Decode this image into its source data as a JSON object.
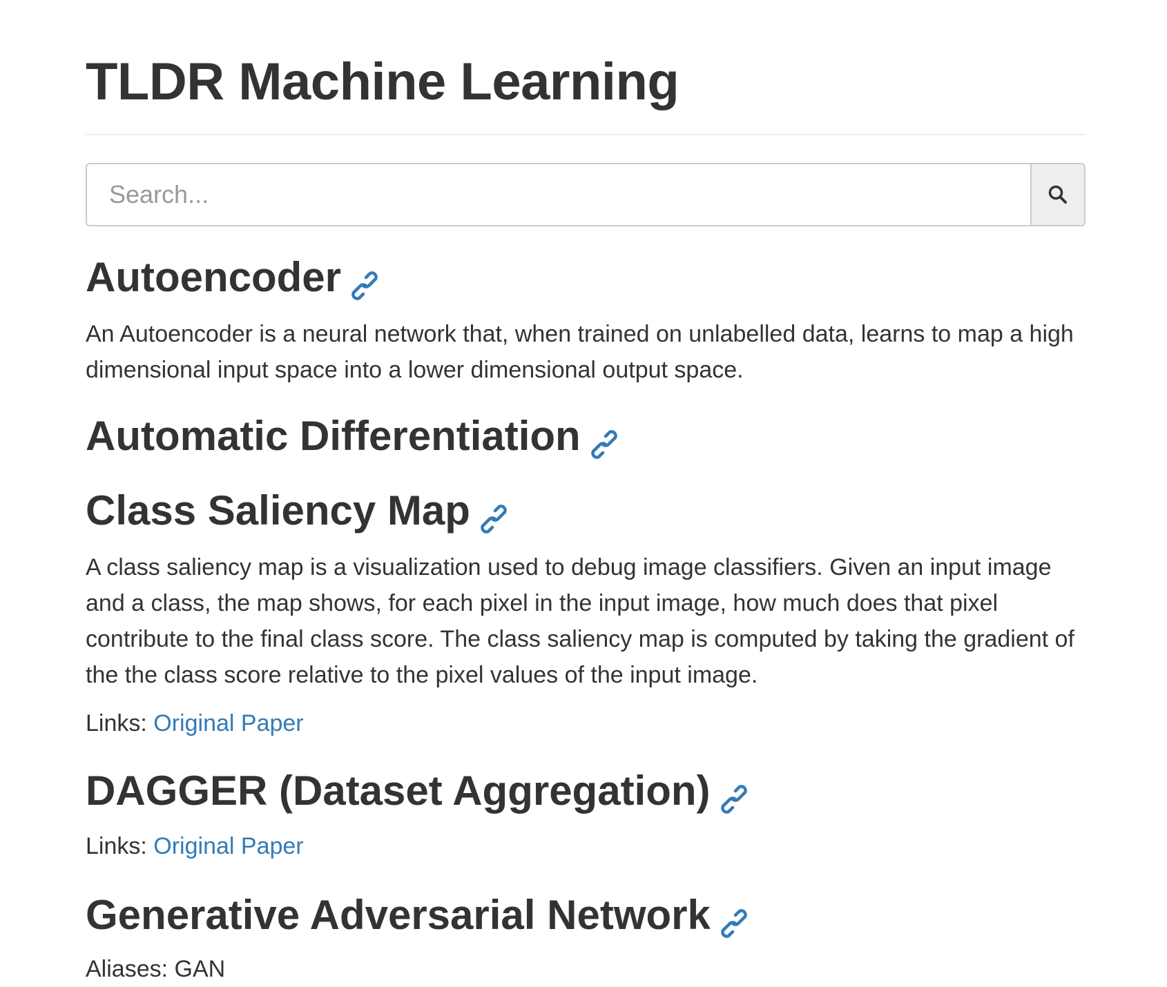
{
  "header": {
    "title": "TLDR Machine Learning"
  },
  "search": {
    "placeholder": "Search...",
    "button_icon": "search-icon"
  },
  "colors": {
    "link": "#337ab7",
    "text": "#333333",
    "divider": "#eeeeee",
    "search_button_bg": "#eeeeee"
  },
  "entries": [
    {
      "title": "Autoencoder",
      "anchor_icon": "link-icon",
      "description": "An Autoencoder is a neural network that, when trained on unlabelled data, learns to map a high dimensional input space into a lower dimensional output space."
    },
    {
      "title": "Automatic Differentiation",
      "anchor_icon": "link-icon"
    },
    {
      "title": "Class Saliency Map",
      "anchor_icon": "link-icon",
      "description": "A class saliency map is a visualization used to debug image classifiers. Given an input image and a class, the map shows, for each pixel in the input image, how much does that pixel contribute to the final class score. The class saliency map is computed by taking the gradient of the the class score relative to the pixel values of the input image.",
      "links_label": "Links:",
      "links": [
        "Original Paper"
      ]
    },
    {
      "title": "DAGGER (Dataset Aggregation)",
      "anchor_icon": "link-icon",
      "links_label": "Links:",
      "links": [
        "Original Paper"
      ]
    },
    {
      "title": "Generative Adversarial Network",
      "anchor_icon": "link-icon",
      "aliases": "Aliases: GAN"
    }
  ]
}
